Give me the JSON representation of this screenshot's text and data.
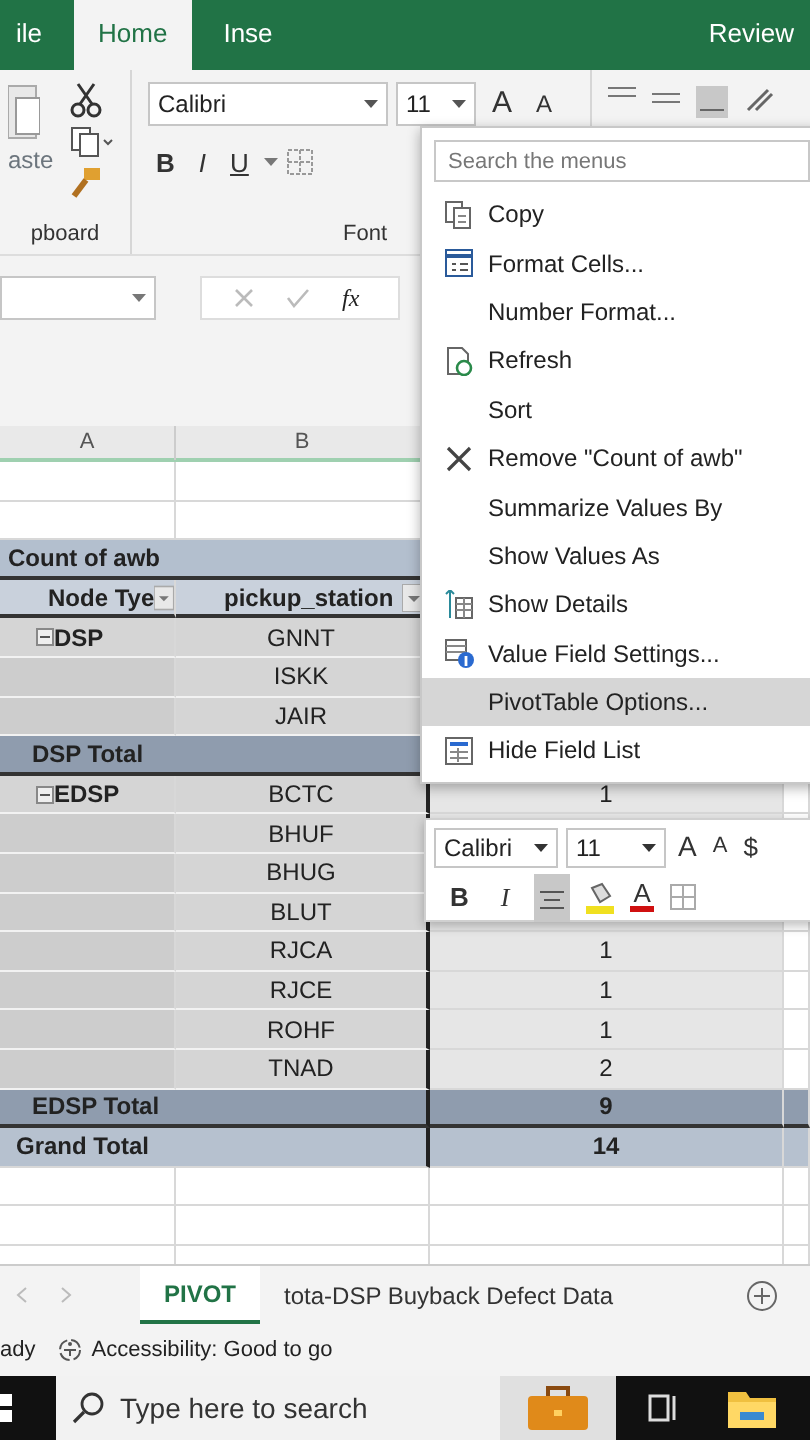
{
  "ribbon_tabs": [
    {
      "label": "ile",
      "selected": false
    },
    {
      "label": "Home",
      "selected": true
    },
    {
      "label": "Inse",
      "selected": false
    },
    {
      "label": "Review",
      "selected": false
    }
  ],
  "ribbon": {
    "paste_label": "aste",
    "clipboard_label": "pboard",
    "font_name": "Calibri",
    "font_size": "11",
    "font_grow": [
      "A",
      "A"
    ],
    "format_buttons": [
      "B",
      "I",
      "U"
    ],
    "font_label": "Font"
  },
  "formula_bar": {
    "function_label": "fx"
  },
  "column_headers": [
    "A",
    "B"
  ],
  "pivot_rows": [
    {
      "kind": "title",
      "label": "Count of awb"
    },
    {
      "kind": "header",
      "node": "Node Tye",
      "station": "pickup_station"
    },
    {
      "kind": "item",
      "node": "DSP",
      "station": "GNNT"
    },
    {
      "kind": "item",
      "station": "ISKK"
    },
    {
      "kind": "item",
      "station": "JAIR"
    },
    {
      "kind": "subtotal",
      "label": "DSP Total"
    },
    {
      "kind": "item",
      "node": "EDSP",
      "station": "BCTC",
      "value": "1"
    },
    {
      "kind": "item",
      "station": "BHUF"
    },
    {
      "kind": "item",
      "station": "BHUG"
    },
    {
      "kind": "item",
      "station": "BLUT"
    },
    {
      "kind": "item",
      "station": "RJCA",
      "value": "1"
    },
    {
      "kind": "item",
      "station": "RJCE",
      "value": "1"
    },
    {
      "kind": "item",
      "station": "ROHF",
      "value": "1"
    },
    {
      "kind": "item",
      "station": "TNAD",
      "value": "2"
    },
    {
      "kind": "subtotal",
      "label": "EDSP Total",
      "value": "9"
    },
    {
      "kind": "grand",
      "label": "Grand Total",
      "value": "14"
    }
  ],
  "context_menu": {
    "search_placeholder": "Search the menus",
    "items": [
      {
        "label": "Copy",
        "kind": "copy",
        "selected": false
      },
      {
        "label": "Format Cells...",
        "kind": "format",
        "selected": false
      },
      {
        "label": "Number Format...",
        "kind": "plain",
        "selected": false
      },
      {
        "label": "Refresh",
        "kind": "refresh",
        "selected": false
      },
      {
        "label": "Sort",
        "kind": "plain",
        "selected": false
      },
      {
        "label": "Remove \"Count of awb\"",
        "kind": "remove",
        "selected": false
      },
      {
        "label": "Summarize Values By",
        "kind": "plain",
        "selected": false
      },
      {
        "label": "Show Values As",
        "kind": "plain",
        "selected": false
      },
      {
        "label": "Show Details",
        "kind": "details",
        "selected": false
      },
      {
        "label": "Value Field Settings...",
        "kind": "settings",
        "selected": false
      },
      {
        "label": "PivotTable Options...",
        "kind": "plain",
        "selected": true
      },
      {
        "label": "Hide Field List",
        "kind": "fieldlist",
        "selected": false
      }
    ]
  },
  "mini_toolbar": {
    "font_name": "Calibri",
    "font_size": "11",
    "font_grow": [
      "A",
      "A"
    ],
    "currency": "$",
    "bold": "B",
    "italic": "I",
    "align_active": true,
    "font_color_label": "A"
  },
  "sheet_tabs": [
    {
      "label": "PIVOT",
      "selected": true
    },
    {
      "label": "tota-DSP Buyback Defect Data",
      "selected": false
    }
  ],
  "status_bar": {
    "mode": "ady",
    "accessibility": "Accessibility: Good to go"
  },
  "taskbar": {
    "search_placeholder": "Type here to search"
  }
}
